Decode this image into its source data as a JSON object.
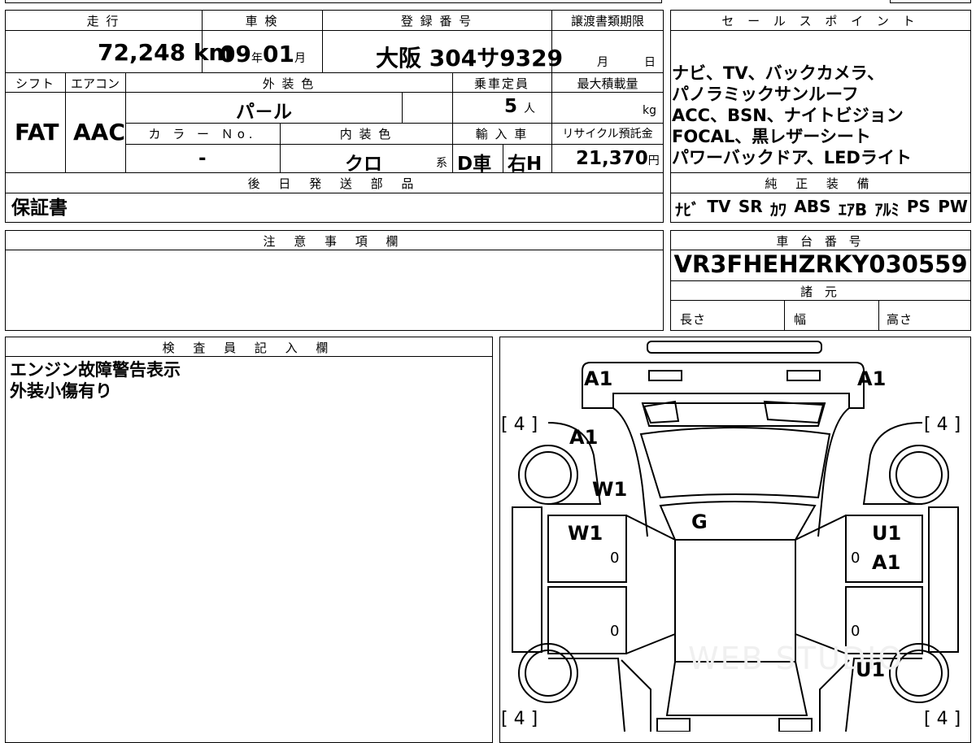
{
  "top_row": {
    "mileage_header": "走 行",
    "inspection_header": "車 検",
    "reg_header": "登 録 番 号",
    "transfer_header": "譲渡書類期限",
    "mileage_value": "72,248",
    "mileage_unit": "km",
    "insp_year": "09",
    "insp_year_unit": "年",
    "insp_month": "01",
    "insp_month_unit": "月",
    "reg_value": "大阪 304サ9329",
    "transfer_month": "月",
    "transfer_day": "日"
  },
  "second_row": {
    "shift_header": "シフト",
    "ac_header": "エアコン",
    "exterior_color_header": "外 装 色",
    "capacity_header": "乗車定員",
    "max_load_header": "最大積載量",
    "shift_value": "FAT",
    "ac_value": "AAC",
    "exterior_color_value": "パ－ル",
    "capacity_value": "5",
    "capacity_unit": "人",
    "max_load_unit": "kg",
    "color_no_header": "カ ラ ー Ｎo.",
    "interior_color_header": "内 装 色",
    "import_header": "輸 入 車",
    "recycle_header": "リサイクル預託金",
    "color_no_value": "-",
    "interior_color_value": "クロ",
    "interior_color_suffix": "系",
    "import_value_1": "D車",
    "import_value_2": "右H",
    "recycle_value": "21,370",
    "recycle_unit": "円"
  },
  "later_parts": {
    "header": "後 日 発 送 部 品",
    "value": "保証書"
  },
  "sales_points": {
    "header": "セ ー ル ス ポ イ ン ト",
    "lines": [
      "ナビ、TV、バックカメラ、",
      "パノラミックサンルーフ",
      "ACC、BSN、ナイトビジョン",
      "FOCAL、黒レザーシート",
      "パワーバックドア、LEDライト"
    ]
  },
  "genuine_equipment": {
    "header": "純 正 装 備",
    "items": [
      "ﾅﾋﾞ",
      "TV",
      "SR",
      "ｶﾜ",
      "ABS",
      "ｴｱB",
      "ｱﾙﾐ",
      "PS",
      "PW"
    ]
  },
  "notes": {
    "header": "注 意 事 項 欄"
  },
  "chassis": {
    "header": "車 台 番 号",
    "value": "VR3FHEHZRKY030559",
    "specs_header": "諸 元",
    "length_label": "長さ",
    "width_label": "幅",
    "height_label": "高さ"
  },
  "inspector": {
    "header": "検 査 員 記 入 欄",
    "lines": [
      "エンジン故障警告表示",
      "外装小傷有り"
    ]
  },
  "diagram": {
    "marks": {
      "front_left": "A1",
      "front_right": "A1",
      "hood_left": "A1",
      "fender_left": "W1",
      "roof": "G",
      "front_door_left": "W1",
      "front_door_right": "U1",
      "front_door_right_2": "A1",
      "rear_right": "U1",
      "zero_1": "0",
      "zero_2": "0",
      "zero_3": "0",
      "zero_4": "0"
    },
    "tire_front_left": "[ 4 ]",
    "tire_front_right": "[ 4 ]",
    "tire_rear_left": "[ 4 ]",
    "tire_rear_right": "[ 4 ]",
    "watermark": "WEB STUDIO"
  }
}
